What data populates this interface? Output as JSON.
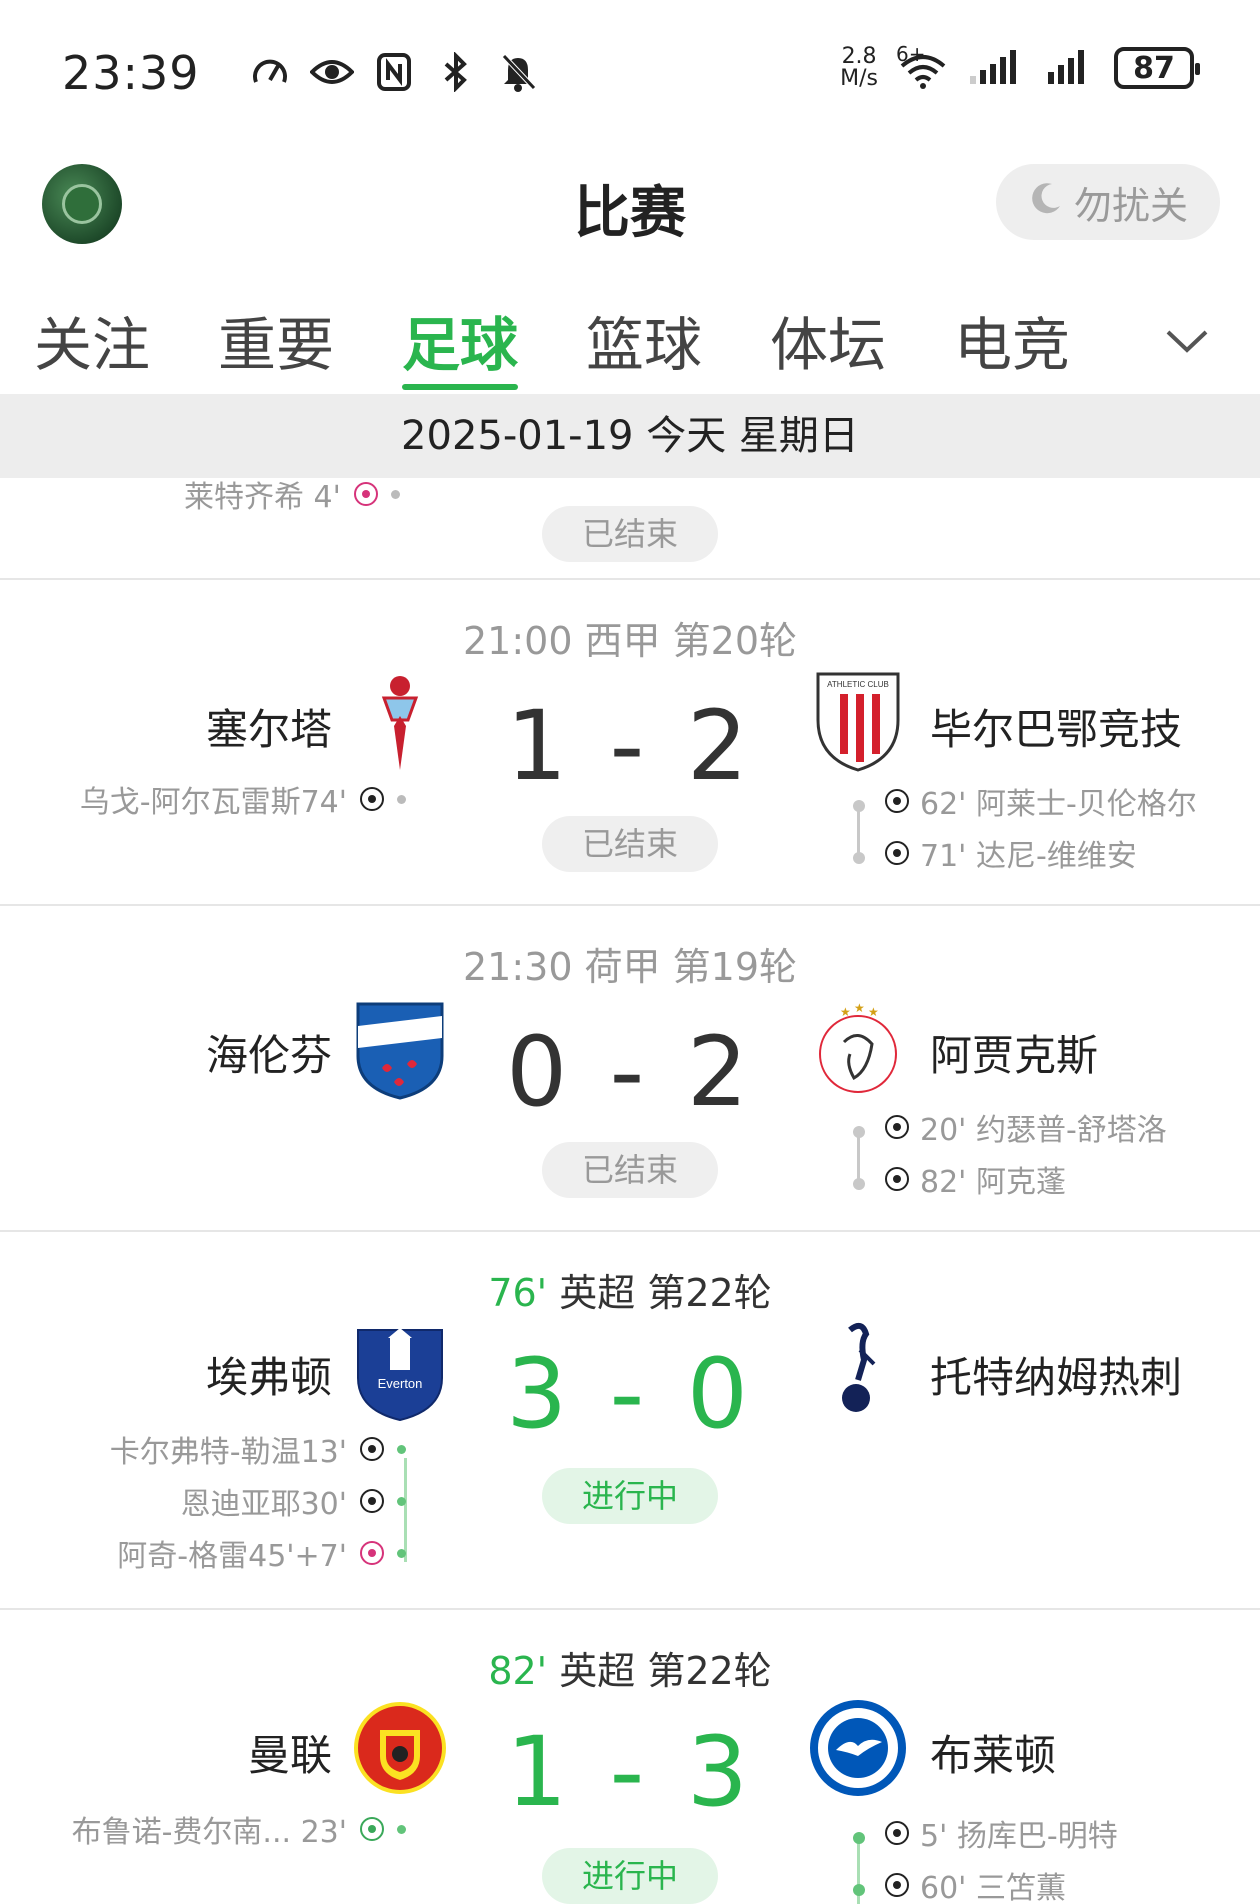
{
  "status_bar": {
    "time": "23:39",
    "net_speed_value": "2.8",
    "net_speed_unit": "M/s",
    "wifi_label": "6+",
    "battery": "87"
  },
  "header": {
    "title": "比赛",
    "dnd_label": "勿扰关"
  },
  "tabs": [
    "关注",
    "重要",
    "足球",
    "篮球",
    "体坛",
    "电竞"
  ],
  "active_tab": "足球",
  "date_bar": "2025-01-19 今天 星期日",
  "partial_match": {
    "home_event": "莱特齐希 4'",
    "status": "已结束"
  },
  "matches": [
    {
      "meta": "21:00 西甲 第20轮",
      "home": "塞尔塔",
      "away": "毕尔巴鄂竞技",
      "score": "1 - 2",
      "status": "已结束",
      "home_events": [
        "乌戈-阿尔瓦雷斯74'"
      ],
      "away_events": [
        "62' 阿莱士-贝伦格尔",
        "71' 达尼-维维安"
      ]
    },
    {
      "meta": "21:30 荷甲 第19轮",
      "home": "海伦芬",
      "away": "阿贾克斯",
      "score": "0 - 2",
      "status": "已结束",
      "home_events": [],
      "away_events": [
        "20' 约瑟普-舒塔洛",
        "82' 阿克蓬"
      ]
    },
    {
      "minute": "76'",
      "meta": "英超 第22轮",
      "home": "埃弗顿",
      "away": "托特纳姆热刺",
      "score": "3 - 0",
      "status": "进行中",
      "home_events": [
        "卡尔弗特-勒温13'",
        "恩迪亚耶30'",
        "阿奇-格雷45'+7'"
      ],
      "away_events": []
    },
    {
      "minute": "82'",
      "meta": "英超 第22轮",
      "home": "曼联",
      "away": "布莱顿",
      "score": "1 - 3",
      "status": "进行中",
      "home_events": [
        "布鲁诺-费尔南... 23'"
      ],
      "away_events": [
        "5' 扬库巴-明特",
        "60' 三笘薫"
      ]
    }
  ],
  "colors": {
    "accent": "#2ab54e",
    "muted": "#999999",
    "own_goal_ball": "#d6337a"
  },
  "icons": [
    "eye-icon",
    "nfc-icon",
    "bluetooth-icon",
    "bell-off-icon",
    "wifi-icon",
    "signal-icon",
    "moon-icon",
    "chevron-down-icon",
    "football-icon"
  ]
}
